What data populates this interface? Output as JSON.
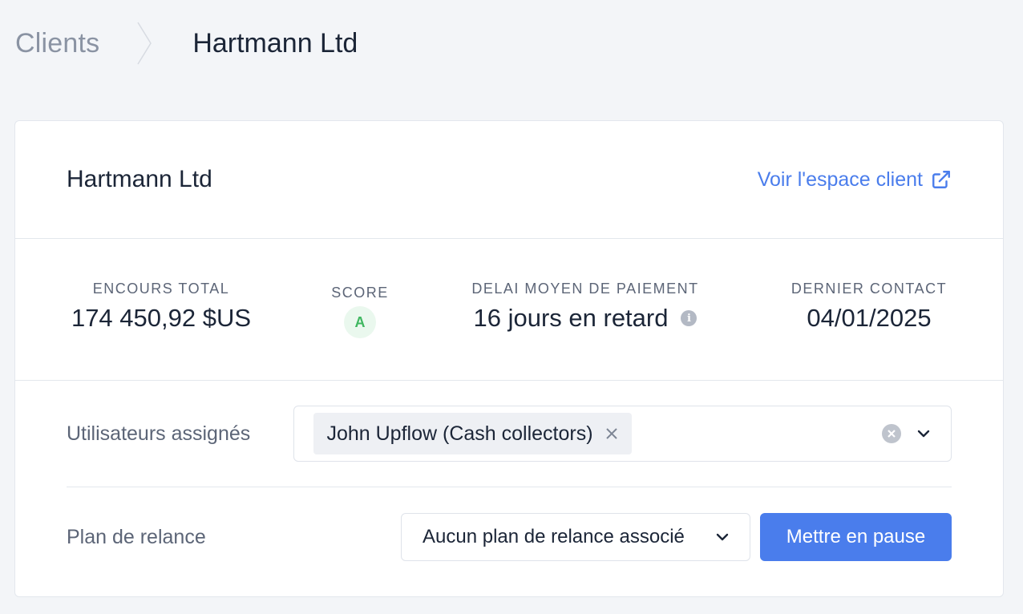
{
  "breadcrumb": {
    "parent": "Clients",
    "current": "Hartmann Ltd"
  },
  "card": {
    "title": "Hartmann Ltd",
    "portal_link": "Voir l'espace client"
  },
  "stats": {
    "total": {
      "label": "ENCOURS TOTAL",
      "value": "174 450,92 $US"
    },
    "score": {
      "label": "SCORE",
      "value": "A"
    },
    "delay": {
      "label": "DELAI MOYEN DE PAIEMENT",
      "value": "16 jours en retard"
    },
    "contact": {
      "label": "DERNIER CONTACT",
      "value": "04/01/2025"
    }
  },
  "assigned_users": {
    "label": "Utilisateurs assignés",
    "chips": [
      "John Upflow (Cash collectors)"
    ]
  },
  "dunning_plan": {
    "label": "Plan de relance",
    "selected": "Aucun plan de relance associé",
    "pause_button": "Mettre en pause"
  },
  "colors": {
    "accent": "#4a7dec",
    "score_green": "#3fb760",
    "muted_text": "#5c6577"
  }
}
